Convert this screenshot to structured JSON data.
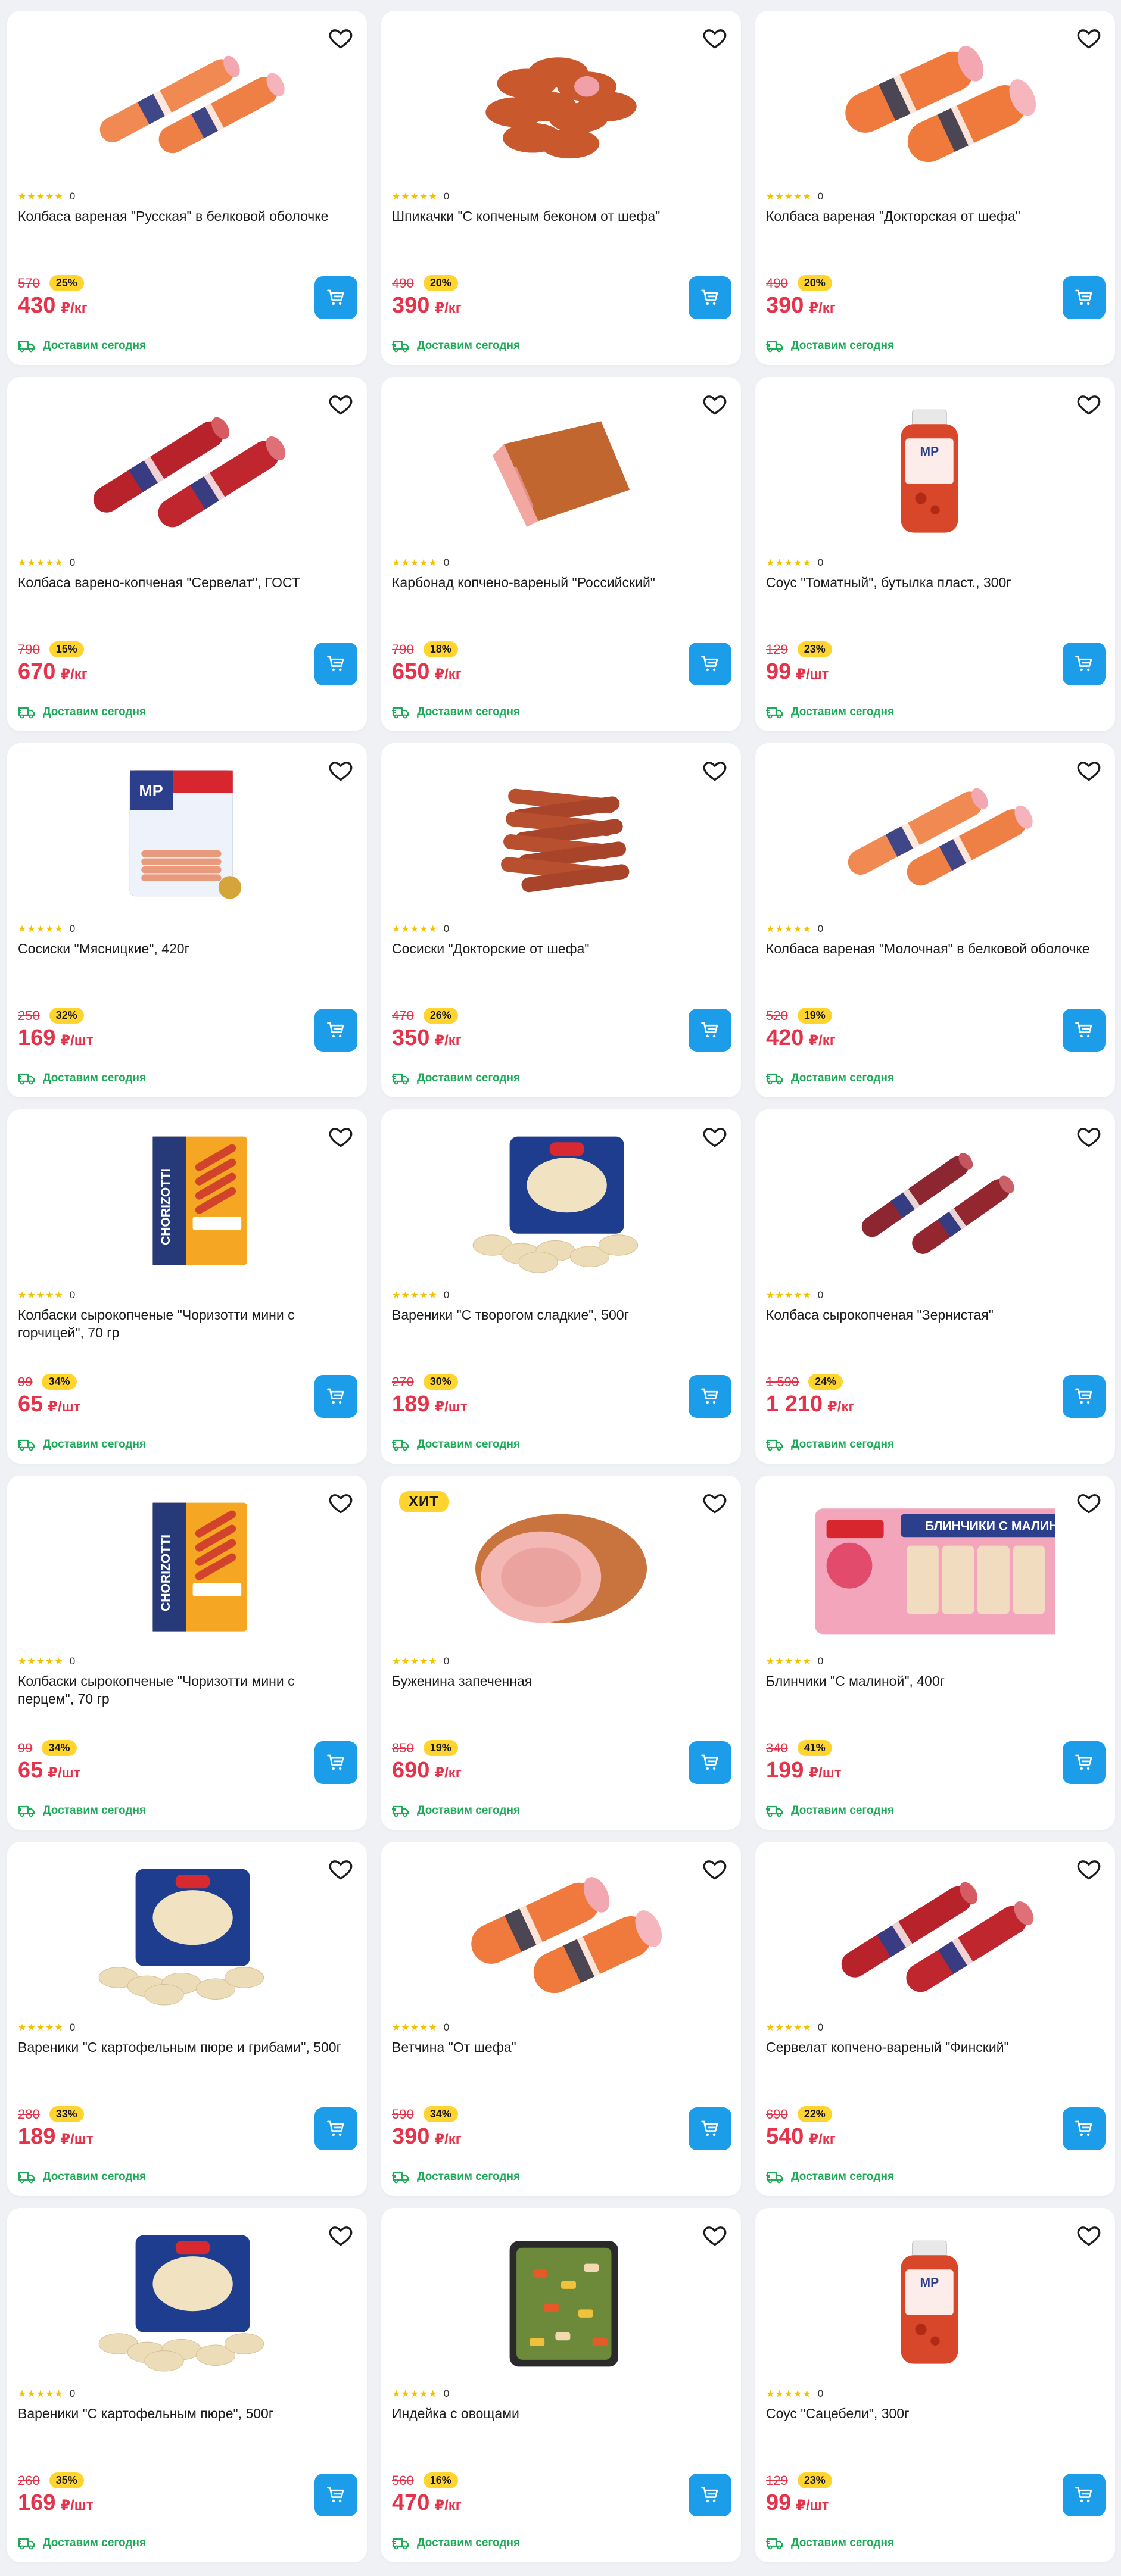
{
  "delivery_label": "Доставим сегодня",
  "hit_label": "ХИТ",
  "stars": "★★★★★",
  "colors": {
    "accent": "#1b9dea",
    "price": "#e5334b",
    "discount_bg": "#ffd42e",
    "delivery": "#1faa59"
  },
  "products": [
    {
      "title": "Колбаса вареная \"Русская\" в белковой оболочке",
      "rating_count": "0",
      "old_price": "570",
      "discount": "25%",
      "price": "430",
      "unit": "₽/кг",
      "image": "sausage-orange-pair"
    },
    {
      "title": "Шпикачки \"С копченым беконом от шефа\"",
      "rating_count": "0",
      "old_price": "490",
      "discount": "20%",
      "price": "390",
      "unit": "₽/кг",
      "image": "sausage-links"
    },
    {
      "title": "Колбаса вареная \"Докторская от шефа\"",
      "rating_count": "0",
      "old_price": "490",
      "discount": "20%",
      "price": "390",
      "unit": "₽/кг",
      "image": "sausage-orange-big"
    },
    {
      "title": "Колбаса варено-копченая \"Сервелат\", ГОСТ",
      "rating_count": "0",
      "old_price": "790",
      "discount": "15%",
      "price": "670",
      "unit": "₽/кг",
      "image": "sausage-red-pair"
    },
    {
      "title": "Карбонад копчено-вареный \"Российский\"",
      "rating_count": "0",
      "old_price": "790",
      "discount": "18%",
      "price": "650",
      "unit": "₽/кг",
      "image": "ham-block"
    },
    {
      "title": "Соус \"Томатный\", бутылка пласт., 300г",
      "rating_count": "0",
      "old_price": "129",
      "discount": "23%",
      "price": "99",
      "unit": "₽/шт",
      "image": "sauce-bottle"
    },
    {
      "title": "Сосиски \"Мясницкие\", 420г",
      "rating_count": "0",
      "old_price": "250",
      "discount": "32%",
      "price": "169",
      "unit": "₽/шт",
      "image": "sausage-pack"
    },
    {
      "title": "Сосиски \"Докторские от шефа\"",
      "rating_count": "0",
      "old_price": "470",
      "discount": "26%",
      "price": "350",
      "unit": "₽/кг",
      "image": "franks-pile"
    },
    {
      "title": "Колбаса вареная \"Молочная\" в белковой оболочке",
      "rating_count": "0",
      "old_price": "520",
      "discount": "19%",
      "price": "420",
      "unit": "₽/кг",
      "image": "sausage-orange-pair"
    },
    {
      "title": "Колбаски сырокопченые \"Чоризотти мини с горчицей\", 70 гр",
      "rating_count": "0",
      "old_price": "99",
      "discount": "34%",
      "price": "65",
      "unit": "₽/шт",
      "image": "chorizotti-pack"
    },
    {
      "title": "Вареники \"С творогом сладкие\", 500г",
      "rating_count": "0",
      "old_price": "270",
      "discount": "30%",
      "price": "189",
      "unit": "₽/шт",
      "image": "dumpling-pack"
    },
    {
      "title": "Колбаса сырокопченая \"Зернистая\"",
      "rating_count": "0",
      "old_price": "1 590",
      "discount": "24%",
      "price": "1 210",
      "unit": "₽/кг",
      "image": "sausage-darkred-pair"
    },
    {
      "title": "Колбаски сырокопченые \"Чоризотти мини с перцем\", 70 гр",
      "rating_count": "0",
      "old_price": "99",
      "discount": "34%",
      "price": "65",
      "unit": "₽/шт",
      "image": "chorizotti-pack"
    },
    {
      "title": "Буженина запеченная",
      "rating_count": "0",
      "old_price": "850",
      "discount": "19%",
      "price": "690",
      "unit": "₽/кг",
      "image": "roast-ham",
      "hit": true
    },
    {
      "title": "Блинчики \"С малиной\", 400г",
      "rating_count": "0",
      "old_price": "340",
      "discount": "41%",
      "price": "199",
      "unit": "₽/шт",
      "image": "pancake-tray"
    },
    {
      "title": "Вареники \"С картофельным пюре и грибами\", 500г",
      "rating_count": "0",
      "old_price": "280",
      "discount": "33%",
      "price": "189",
      "unit": "₽/шт",
      "image": "dumpling-pack"
    },
    {
      "title": "Ветчина \"От шефа\"",
      "rating_count": "0",
      "old_price": "590",
      "discount": "34%",
      "price": "390",
      "unit": "₽/кг",
      "image": "sausage-orange-big"
    },
    {
      "title": "Сервелат копчено-вареный \"Финский\"",
      "rating_count": "0",
      "old_price": "690",
      "discount": "22%",
      "price": "540",
      "unit": "₽/кг",
      "image": "sausage-red-pair"
    },
    {
      "title": "Вареники \"С картофельным пюре\", 500г",
      "rating_count": "0",
      "old_price": "260",
      "discount": "35%",
      "price": "169",
      "unit": "₽/шт",
      "image": "dumpling-pack"
    },
    {
      "title": "Индейка с овощами",
      "rating_count": "0",
      "old_price": "560",
      "discount": "16%",
      "price": "470",
      "unit": "₽/кг",
      "image": "turkey-tray"
    },
    {
      "title": "Соус \"Сацебели\", 300г",
      "rating_count": "0",
      "old_price": "129",
      "discount": "23%",
      "price": "99",
      "unit": "₽/шт",
      "image": "sauce-bottle"
    }
  ]
}
